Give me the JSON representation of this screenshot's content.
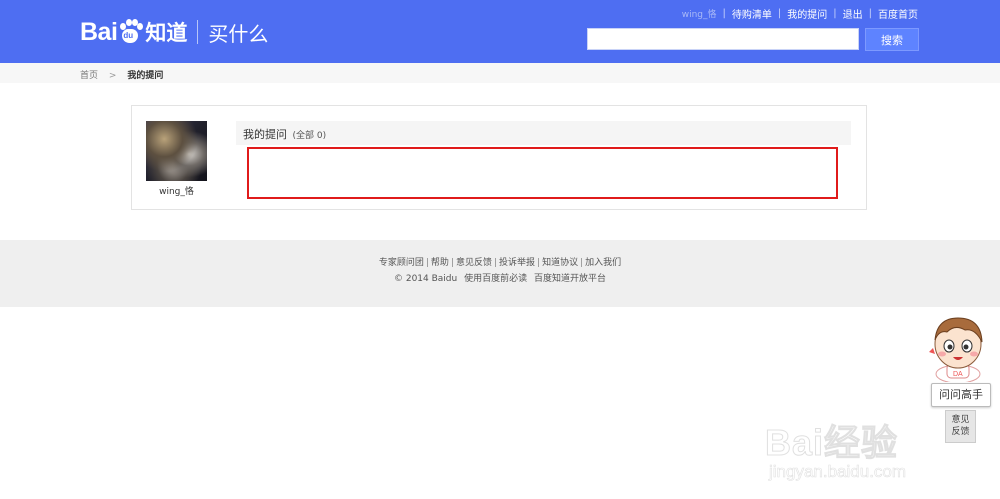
{
  "header": {
    "logo_text": "Bai",
    "logo_paw_text": "du",
    "logo_product": "知道",
    "logo_sub": "买什么",
    "nav": [
      "wing_恪",
      "待购清单",
      "我的提问",
      "退出",
      "百度首页"
    ],
    "search_placeholder": "",
    "search_button": "搜索"
  },
  "breadcrumb": {
    "home": "首页",
    "separator": ">",
    "current": "我的提问"
  },
  "profile": {
    "username": "wing_恪"
  },
  "questions": {
    "title": "我的提问",
    "count_label": "(全部 0)"
  },
  "footer": {
    "links": [
      "专家顾问团",
      "帮助",
      "意见反馈",
      "投诉举报",
      "知道协议",
      "加入我们"
    ],
    "copyright": "© 2014 Baidu",
    "extra_links": [
      "使用百度前必读",
      "百度知道开放平台"
    ]
  },
  "widget": {
    "ask_label": "问问高手",
    "feedback_label_1": "意见",
    "feedback_label_2": "反馈"
  },
  "watermark": {
    "main": "Bai经验",
    "url": "jingyan.baidu.com"
  },
  "colors": {
    "header_bg": "#4e6ef2",
    "highlight_border": "#e01b1b",
    "footer_bg": "#efefef"
  }
}
